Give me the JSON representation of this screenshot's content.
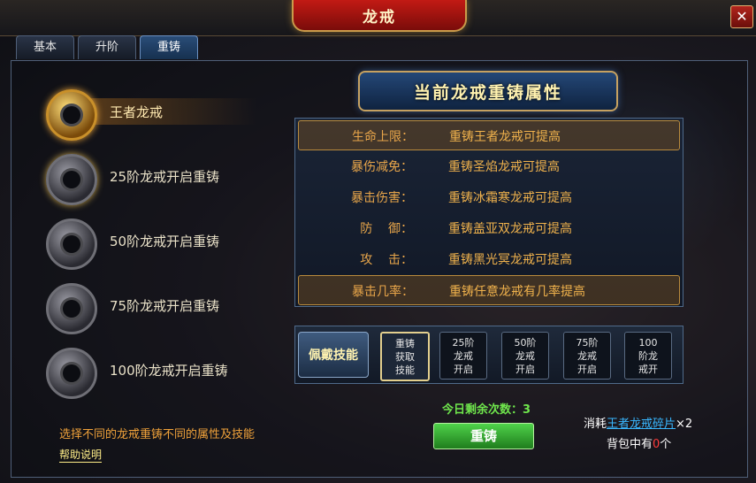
{
  "window": {
    "title": "龙戒",
    "close_icon": "close-icon"
  },
  "tabs": [
    {
      "label": "基本",
      "active": false
    },
    {
      "label": "升阶",
      "active": false
    },
    {
      "label": "重铸",
      "active": true
    }
  ],
  "rings": [
    {
      "label": "王者龙戒",
      "selected": true,
      "icon": "gold-ring-icon"
    },
    {
      "label": "25阶龙戒开启重铸",
      "selected": false,
      "icon": "silver-ring-icon"
    },
    {
      "label": "50阶龙戒开启重铸",
      "selected": false,
      "icon": "silver-ring-icon"
    },
    {
      "label": "75阶龙戒开启重铸",
      "selected": false,
      "icon": "silver-ring-icon"
    },
    {
      "label": "100阶龙戒开启重铸",
      "selected": false,
      "icon": "silver-ring-icon"
    }
  ],
  "hint": "选择不同的龙戒重铸不同的属性及技能",
  "help_link": "帮助说明",
  "attributes": {
    "header": "当前龙戒重铸属性",
    "rows": [
      {
        "name": "生命上限：",
        "value": "重铸王者龙戒可提高"
      },
      {
        "name": "暴伤减免：",
        "value": "重铸圣焰龙戒可提高"
      },
      {
        "name": "暴击伤害：",
        "value": "重铸冰霜寒龙戒可提高"
      },
      {
        "name": "防    御：",
        "value": "重铸盖亚双龙戒可提高"
      },
      {
        "name": "攻    击：",
        "value": "重铸黑光冥龙戒可提高"
      },
      {
        "name": "暴击几率：",
        "value": "重铸任意龙戒有几率提高"
      }
    ]
  },
  "skills": {
    "label": "佩戴技能",
    "slots": [
      {
        "text": "重铸\n获取\n技能",
        "active": true
      },
      {
        "text": "25阶\n龙戒\n开启",
        "active": false
      },
      {
        "text": "50阶\n龙戒\n开启",
        "active": false
      },
      {
        "text": "75阶\n龙戒\n开启",
        "active": false
      },
      {
        "text": "100\n阶龙\n戒开",
        "active": false
      }
    ]
  },
  "remaining": "今日剩余次数：3",
  "reforge_button": "重铸",
  "consume": {
    "prefix": "消耗",
    "item": "王者龙戒碎片",
    "count": "×2"
  },
  "bag": {
    "prefix": "背包中有",
    "count": "0",
    "suffix": "个"
  },
  "colors": {
    "accent_gold": "#c6a160",
    "title_red": "#c21a14",
    "button_green": "#3cc23a"
  }
}
